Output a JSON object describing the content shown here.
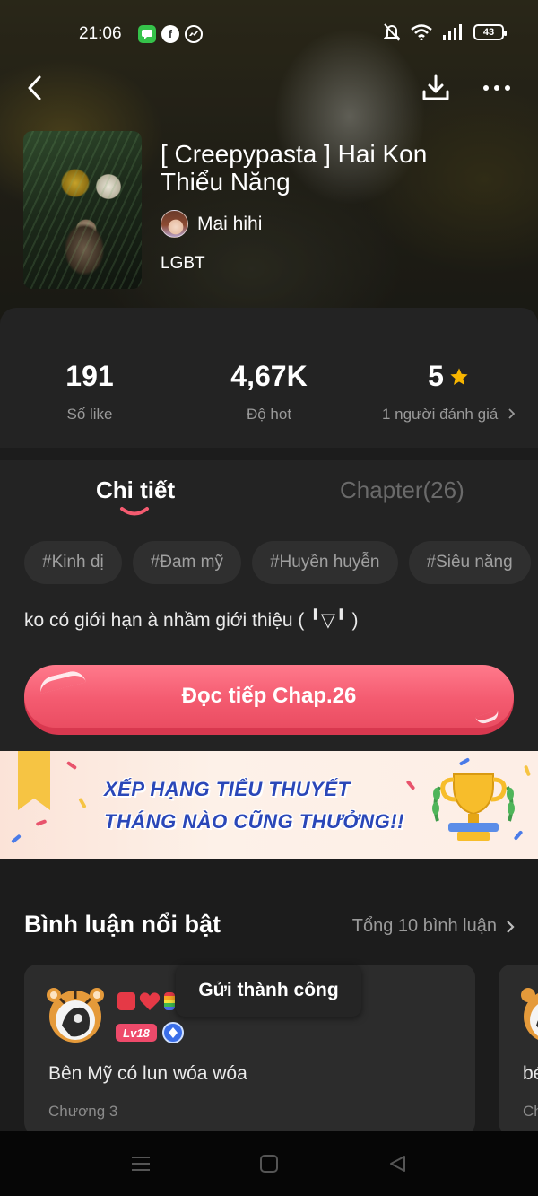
{
  "status_bar": {
    "time": "21:06",
    "battery": "43",
    "notification_icons": [
      "messages-icon",
      "facebook-icon",
      "messenger-icon"
    ],
    "system_icons": [
      "mute-bell-icon",
      "wifi-icon",
      "signal-icon",
      "battery-icon"
    ]
  },
  "story": {
    "title": "[ Creepypasta ] Hai Kon Thiểu Năng",
    "author": "Mai hihi",
    "category": "LGBT"
  },
  "stats": {
    "likes": {
      "value": "191",
      "label": "Số like"
    },
    "hot": {
      "value": "4,67K",
      "label": "Độ hot"
    },
    "rating": {
      "value": "5",
      "label": "1 người đánh giá",
      "star_color": "#f7b500"
    }
  },
  "tabs": [
    {
      "label": "Chi tiết",
      "active": true
    },
    {
      "label": "Chapter(26)",
      "active": false
    }
  ],
  "tags": [
    "#Kinh dị",
    "#Đam mỹ",
    "#Huyền huyễn",
    "#Siêu năng"
  ],
  "description": "ko có giới hạn à nhầm giới thiệu ( ╹▽╹ )",
  "read_button": {
    "label": "Đọc tiếp Chap.26",
    "color": "#f45b70"
  },
  "banner": {
    "line1": "XẾP HẠNG TIỂU THUYẾT",
    "line2": "THÁNG NÀO CŨNG THƯỞNG!!",
    "text_color": "#2a47b8"
  },
  "comments": {
    "title": "Bình luận nổi bật",
    "total": "Tổng 10 bình luận",
    "items": [
      {
        "level": "Lv18",
        "text": "Bên Mỹ có lun wóa wóa",
        "chapter": "Chương 3"
      },
      {
        "level": "",
        "text": "bé",
        "chapter": "Ch"
      }
    ]
  },
  "toast": "Gửi thành công",
  "accent_color": "#f45b70"
}
